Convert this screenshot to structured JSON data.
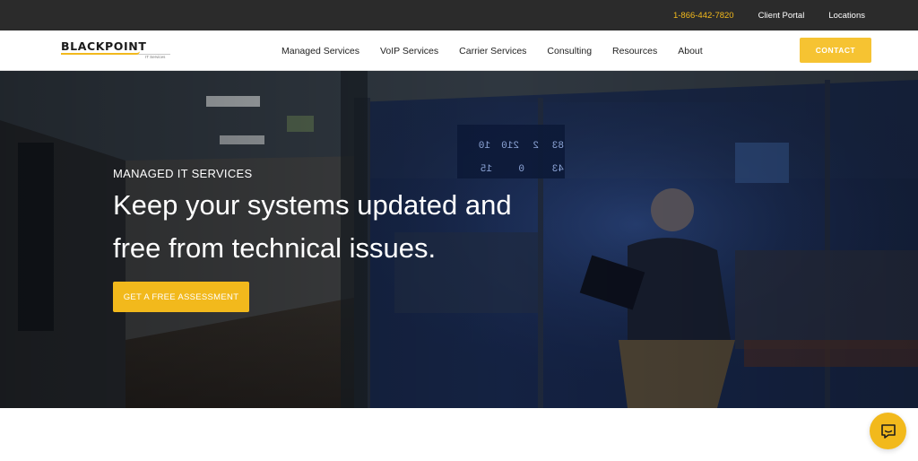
{
  "topbar": {
    "phone": "1-866-442-7820",
    "client_portal": "Client Portal",
    "locations": "Locations"
  },
  "logo": {
    "name": "BLACKPOINT",
    "sub": "IT Services"
  },
  "nav": {
    "items": [
      {
        "label": "Managed Services"
      },
      {
        "label": "VoIP Services"
      },
      {
        "label": "Carrier Services"
      },
      {
        "label": "Consulting"
      },
      {
        "label": "Resources"
      },
      {
        "label": "About"
      }
    ],
    "contact": "CONTACT"
  },
  "hero": {
    "eyebrow": "MANAGED IT SERVICES",
    "headline": "Keep your systems updated and free from technical issues.",
    "cta": "GET A FREE ASSESSMENT"
  },
  "photo_board": {
    "row1": [
      "83",
      "2",
      "210",
      "10"
    ],
    "row2": [
      "43",
      "0",
      "15"
    ]
  },
  "colors": {
    "accent": "#f2b91c",
    "topbar": "#2b2b2b",
    "hero_overlay": "#14234a"
  },
  "icons": {
    "chat": "chat-bubble-icon"
  }
}
